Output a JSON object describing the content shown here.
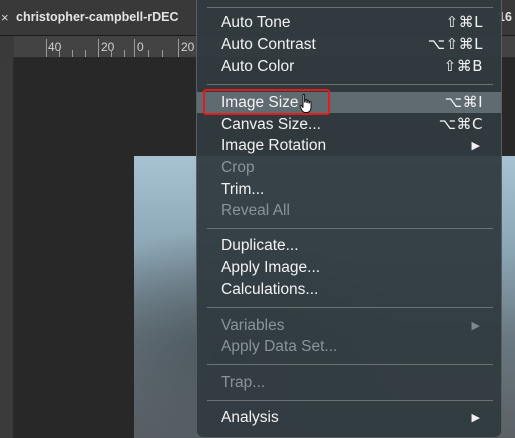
{
  "document": {
    "tab_close_glyph": "×",
    "tab_title": "christopher-campbell-rDEC",
    "tab_title_right": "16",
    "ruler_labels": [
      "40",
      "20",
      "0",
      "20"
    ]
  },
  "menu": {
    "highlight_color": "#5f6a71",
    "focus_box_color": "#e21b1b",
    "groups": [
      [
        {
          "label": "Auto Tone",
          "shortcut": "⇧⌘L",
          "enabled": true
        },
        {
          "label": "Auto Contrast",
          "shortcut": "⌥⇧⌘L",
          "enabled": true
        },
        {
          "label": "Auto Color",
          "shortcut": "⇧⌘B",
          "enabled": true
        }
      ],
      [
        {
          "label": "Image Size...",
          "shortcut": "⌥⌘I",
          "enabled": true,
          "highlighted": true
        },
        {
          "label": "Canvas Size...",
          "shortcut": "⌥⌘C",
          "enabled": true
        },
        {
          "label": "Image Rotation",
          "submenu": "▶",
          "enabled": true
        },
        {
          "label": "Crop",
          "enabled": false
        },
        {
          "label": "Trim...",
          "enabled": true
        },
        {
          "label": "Reveal All",
          "enabled": false
        }
      ],
      [
        {
          "label": "Duplicate...",
          "enabled": true
        },
        {
          "label": "Apply Image...",
          "enabled": true
        },
        {
          "label": "Calculations...",
          "enabled": true
        }
      ],
      [
        {
          "label": "Variables",
          "submenu": "▶",
          "enabled": false
        },
        {
          "label": "Apply Data Set...",
          "enabled": false
        }
      ],
      [
        {
          "label": "Trap...",
          "enabled": false
        }
      ],
      [
        {
          "label": "Analysis",
          "submenu": "▶",
          "enabled": true
        }
      ]
    ]
  }
}
